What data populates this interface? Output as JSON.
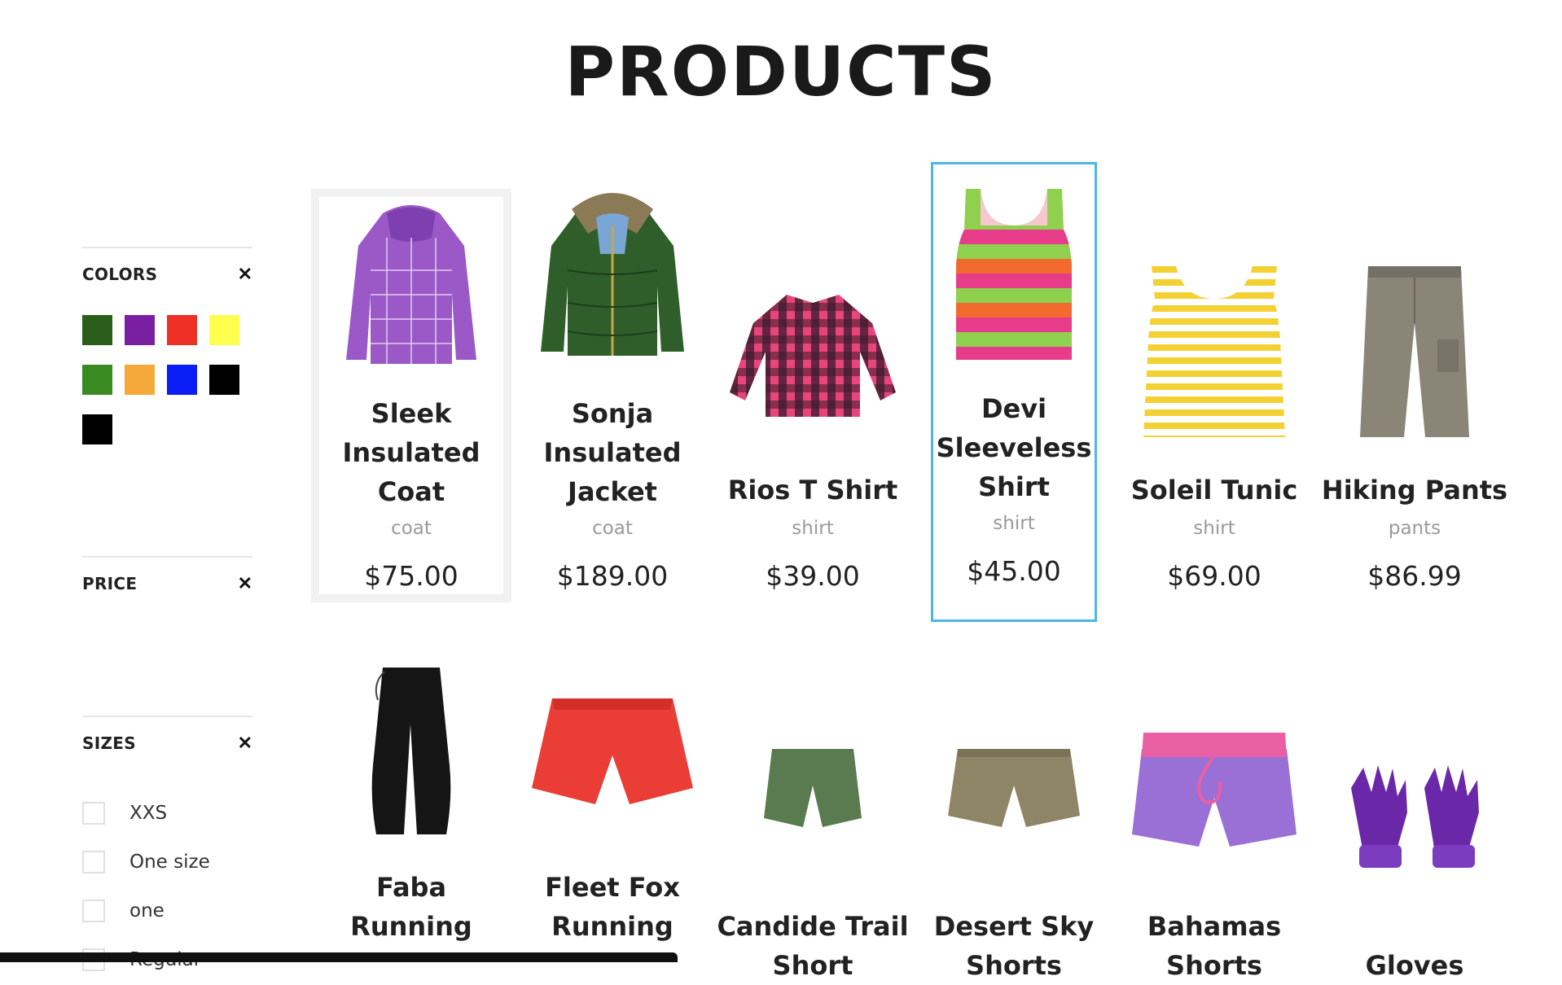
{
  "page_title": "PRODUCTS",
  "filters": {
    "colors": {
      "title": "COLORS",
      "close": "✕",
      "swatches": [
        "#2b5e1a",
        "#7b1fa2",
        "#ee3124",
        "#ffff4d",
        "#3a8a22",
        "#f5a93a",
        "#0a1df5",
        "#000000",
        "#000000"
      ]
    },
    "price": {
      "title": "PRICE",
      "close": "✕"
    },
    "sizes": {
      "title": "SIZES",
      "close": "✕",
      "options": [
        "XXS",
        "One size",
        "one",
        "Regular"
      ]
    }
  },
  "products": [
    {
      "name": "Sleek Insulated Coat",
      "type": "coat",
      "price": "$75.00"
    },
    {
      "name": "Sonja Insulated Jacket",
      "type": "coat",
      "price": "$189.00"
    },
    {
      "name": "Rios T Shirt",
      "type": "shirt",
      "price": "$39.00"
    },
    {
      "name": "Devi Sleeveless Shirt",
      "type": "shirt",
      "price": "$45.00"
    },
    {
      "name": "Soleil Tunic",
      "type": "shirt",
      "price": "$69.00"
    },
    {
      "name": "Hiking Pants",
      "type": "pants",
      "price": "$86.99"
    },
    {
      "name": "Faba Running"
    },
    {
      "name": "Fleet Fox Running"
    },
    {
      "name": "Candide Trail Short"
    },
    {
      "name": "Desert Sky Shorts"
    },
    {
      "name": "Bahamas Shorts"
    },
    {
      "name": "Gloves"
    }
  ]
}
